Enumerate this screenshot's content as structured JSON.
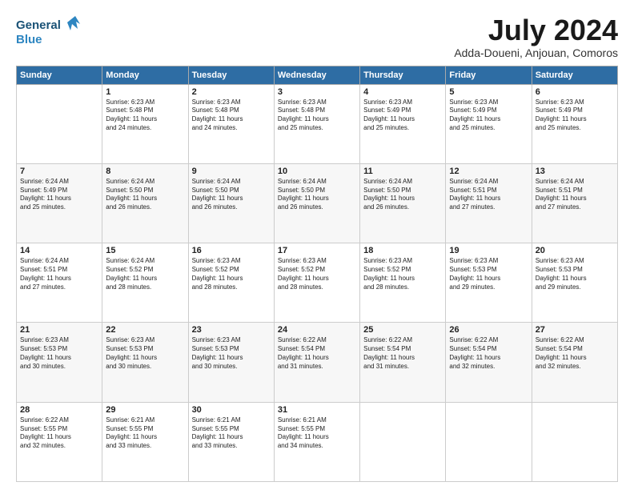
{
  "logo": {
    "line1": "General",
    "line2": "Blue"
  },
  "title": "July 2024",
  "location": "Adda-Doueni, Anjouan, Comoros",
  "days_of_week": [
    "Sunday",
    "Monday",
    "Tuesday",
    "Wednesday",
    "Thursday",
    "Friday",
    "Saturday"
  ],
  "weeks": [
    [
      {
        "num": "",
        "text": ""
      },
      {
        "num": "1",
        "text": "Sunrise: 6:23 AM\nSunset: 5:48 PM\nDaylight: 11 hours\nand 24 minutes."
      },
      {
        "num": "2",
        "text": "Sunrise: 6:23 AM\nSunset: 5:48 PM\nDaylight: 11 hours\nand 24 minutes."
      },
      {
        "num": "3",
        "text": "Sunrise: 6:23 AM\nSunset: 5:48 PM\nDaylight: 11 hours\nand 25 minutes."
      },
      {
        "num": "4",
        "text": "Sunrise: 6:23 AM\nSunset: 5:49 PM\nDaylight: 11 hours\nand 25 minutes."
      },
      {
        "num": "5",
        "text": "Sunrise: 6:23 AM\nSunset: 5:49 PM\nDaylight: 11 hours\nand 25 minutes."
      },
      {
        "num": "6",
        "text": "Sunrise: 6:23 AM\nSunset: 5:49 PM\nDaylight: 11 hours\nand 25 minutes."
      }
    ],
    [
      {
        "num": "7",
        "text": "Sunrise: 6:24 AM\nSunset: 5:49 PM\nDaylight: 11 hours\nand 25 minutes."
      },
      {
        "num": "8",
        "text": "Sunrise: 6:24 AM\nSunset: 5:50 PM\nDaylight: 11 hours\nand 26 minutes."
      },
      {
        "num": "9",
        "text": "Sunrise: 6:24 AM\nSunset: 5:50 PM\nDaylight: 11 hours\nand 26 minutes."
      },
      {
        "num": "10",
        "text": "Sunrise: 6:24 AM\nSunset: 5:50 PM\nDaylight: 11 hours\nand 26 minutes."
      },
      {
        "num": "11",
        "text": "Sunrise: 6:24 AM\nSunset: 5:50 PM\nDaylight: 11 hours\nand 26 minutes."
      },
      {
        "num": "12",
        "text": "Sunrise: 6:24 AM\nSunset: 5:51 PM\nDaylight: 11 hours\nand 27 minutes."
      },
      {
        "num": "13",
        "text": "Sunrise: 6:24 AM\nSunset: 5:51 PM\nDaylight: 11 hours\nand 27 minutes."
      }
    ],
    [
      {
        "num": "14",
        "text": "Sunrise: 6:24 AM\nSunset: 5:51 PM\nDaylight: 11 hours\nand 27 minutes."
      },
      {
        "num": "15",
        "text": "Sunrise: 6:24 AM\nSunset: 5:52 PM\nDaylight: 11 hours\nand 28 minutes."
      },
      {
        "num": "16",
        "text": "Sunrise: 6:23 AM\nSunset: 5:52 PM\nDaylight: 11 hours\nand 28 minutes."
      },
      {
        "num": "17",
        "text": "Sunrise: 6:23 AM\nSunset: 5:52 PM\nDaylight: 11 hours\nand 28 minutes."
      },
      {
        "num": "18",
        "text": "Sunrise: 6:23 AM\nSunset: 5:52 PM\nDaylight: 11 hours\nand 28 minutes."
      },
      {
        "num": "19",
        "text": "Sunrise: 6:23 AM\nSunset: 5:53 PM\nDaylight: 11 hours\nand 29 minutes."
      },
      {
        "num": "20",
        "text": "Sunrise: 6:23 AM\nSunset: 5:53 PM\nDaylight: 11 hours\nand 29 minutes."
      }
    ],
    [
      {
        "num": "21",
        "text": "Sunrise: 6:23 AM\nSunset: 5:53 PM\nDaylight: 11 hours\nand 30 minutes."
      },
      {
        "num": "22",
        "text": "Sunrise: 6:23 AM\nSunset: 5:53 PM\nDaylight: 11 hours\nand 30 minutes."
      },
      {
        "num": "23",
        "text": "Sunrise: 6:23 AM\nSunset: 5:53 PM\nDaylight: 11 hours\nand 30 minutes."
      },
      {
        "num": "24",
        "text": "Sunrise: 6:22 AM\nSunset: 5:54 PM\nDaylight: 11 hours\nand 31 minutes."
      },
      {
        "num": "25",
        "text": "Sunrise: 6:22 AM\nSunset: 5:54 PM\nDaylight: 11 hours\nand 31 minutes."
      },
      {
        "num": "26",
        "text": "Sunrise: 6:22 AM\nSunset: 5:54 PM\nDaylight: 11 hours\nand 32 minutes."
      },
      {
        "num": "27",
        "text": "Sunrise: 6:22 AM\nSunset: 5:54 PM\nDaylight: 11 hours\nand 32 minutes."
      }
    ],
    [
      {
        "num": "28",
        "text": "Sunrise: 6:22 AM\nSunset: 5:55 PM\nDaylight: 11 hours\nand 32 minutes."
      },
      {
        "num": "29",
        "text": "Sunrise: 6:21 AM\nSunset: 5:55 PM\nDaylight: 11 hours\nand 33 minutes."
      },
      {
        "num": "30",
        "text": "Sunrise: 6:21 AM\nSunset: 5:55 PM\nDaylight: 11 hours\nand 33 minutes."
      },
      {
        "num": "31",
        "text": "Sunrise: 6:21 AM\nSunset: 5:55 PM\nDaylight: 11 hours\nand 34 minutes."
      },
      {
        "num": "",
        "text": ""
      },
      {
        "num": "",
        "text": ""
      },
      {
        "num": "",
        "text": ""
      }
    ]
  ]
}
